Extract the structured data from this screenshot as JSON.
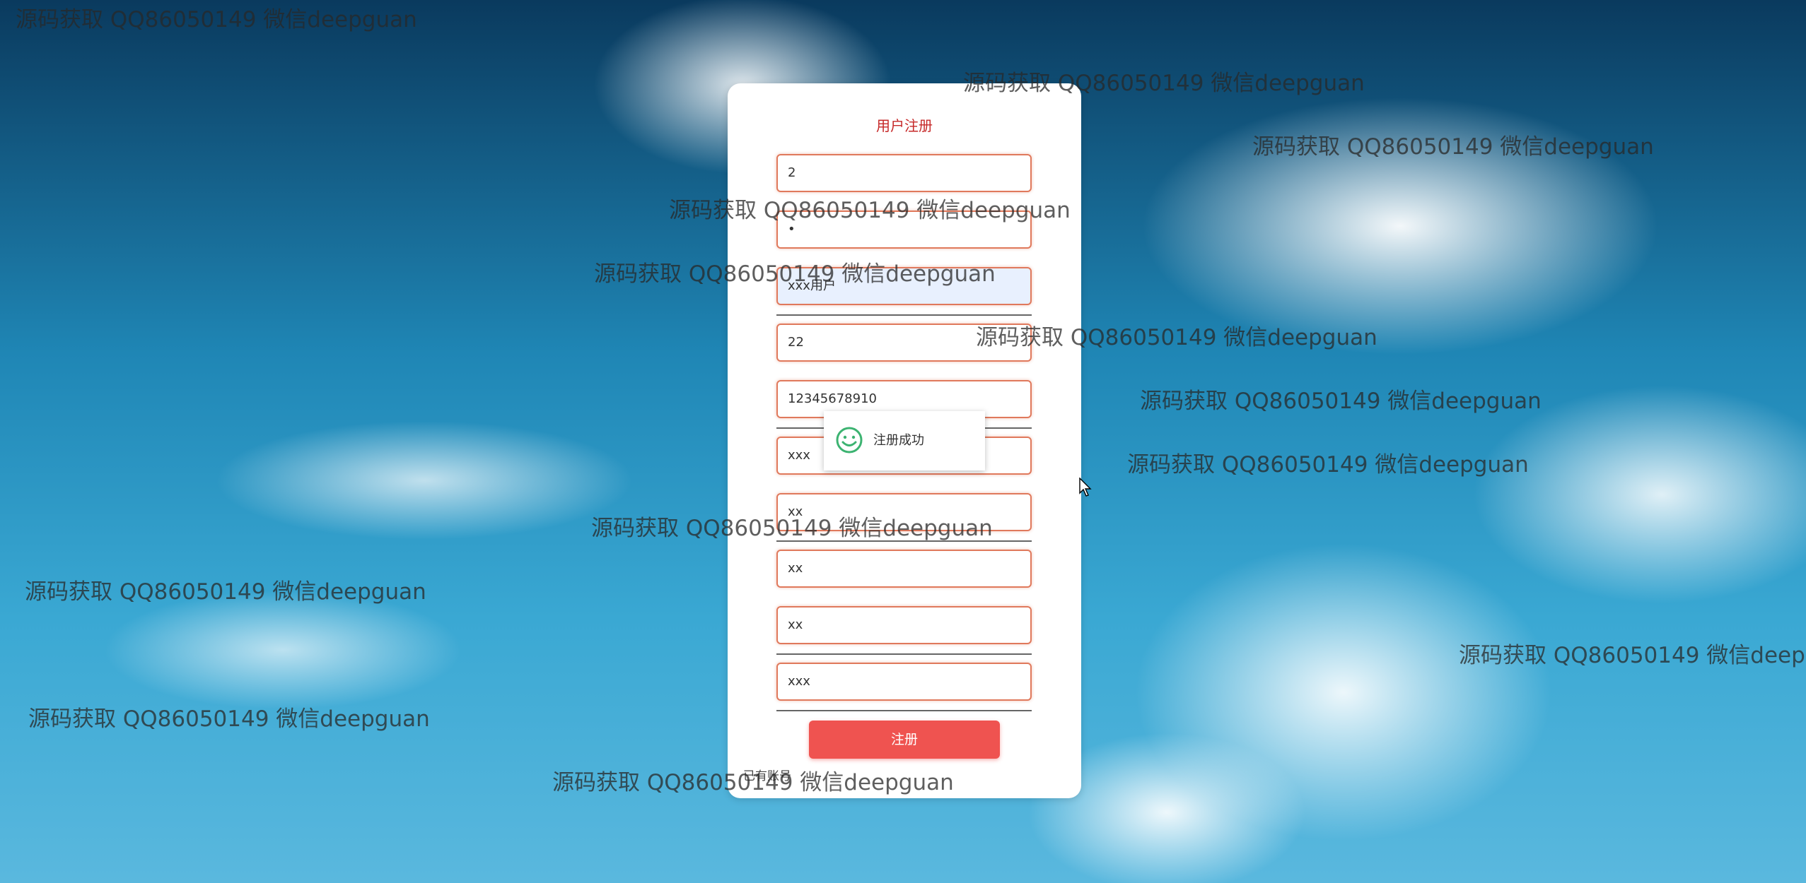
{
  "form": {
    "title": "用户注册",
    "fields": [
      {
        "value": "2"
      },
      {
        "value": "•"
      },
      {
        "value": "xxx用户"
      },
      {
        "value": "22"
      },
      {
        "value": "12345678910"
      },
      {
        "value": "xxx"
      },
      {
        "value": "xx"
      },
      {
        "value": "xx"
      },
      {
        "value": "xx"
      },
      {
        "value": "xxx"
      }
    ],
    "submit_label": "注册",
    "bottom_link": "已有账号"
  },
  "toast": {
    "message": "注册成功",
    "icon": "smiley-icon",
    "icon_color": "#3cb371"
  },
  "watermark_text": "源码获取 QQ86050149 微信deepguan",
  "colors": {
    "title": "#c62828",
    "field_border": "#e0795c",
    "submit_bg": "#ef5350"
  }
}
